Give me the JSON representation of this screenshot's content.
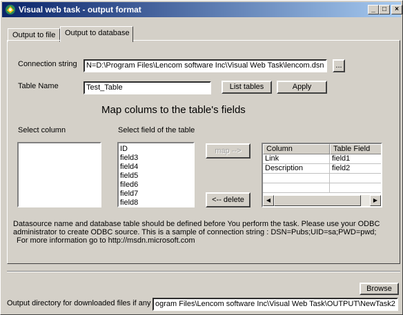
{
  "window": {
    "title": "Visual web task - output format",
    "controls": {
      "minimize": "_",
      "maximize": "□",
      "close": "×"
    }
  },
  "tabs": [
    {
      "label": "Output to file"
    },
    {
      "label": "Output to database"
    }
  ],
  "connection": {
    "label": "Connection string",
    "value": "N=D:\\Program Files\\Lencom software Inc\\Visual Web Task\\lencom.dsn",
    "browse_label": "..."
  },
  "table": {
    "label": "Table Name",
    "value": "Test_Table",
    "list_tables_label": "List tables",
    "apply_label": "Apply"
  },
  "mapping": {
    "heading": "Map colums to the table's fields",
    "select_column_label": "Select column",
    "select_field_label": "Select field of the table",
    "fields": [
      "ID",
      "field3",
      "field4",
      "field5",
      "filed6",
      "field7",
      "field8"
    ],
    "map_label": "map -->",
    "delete_label": "<-- delete",
    "grid": {
      "headers": [
        "Column",
        "Table Field"
      ],
      "rows": [
        [
          "Link",
          "field1"
        ],
        [
          "Description",
          "field2"
        ],
        [
          "",
          ""
        ],
        [
          "",
          ""
        ]
      ]
    }
  },
  "info": {
    "line1": "Datasource name and database table should be defined before You perform the task. Please use your ODBC",
    "line2": "administrator to create ODBC source. This is a sample of connection string :      DSN=Pubs;UID=sa;PWD=pwd;",
    "line3": "For more information go to http://msdn.microsoft.com"
  },
  "output": {
    "browse_label": "Browse",
    "dir_label": "Output directory for downloaded files if any",
    "dir_value": "ogram Files\\Lencom software Inc\\Visual Web Task\\OUTPUT\\NewTask2"
  }
}
